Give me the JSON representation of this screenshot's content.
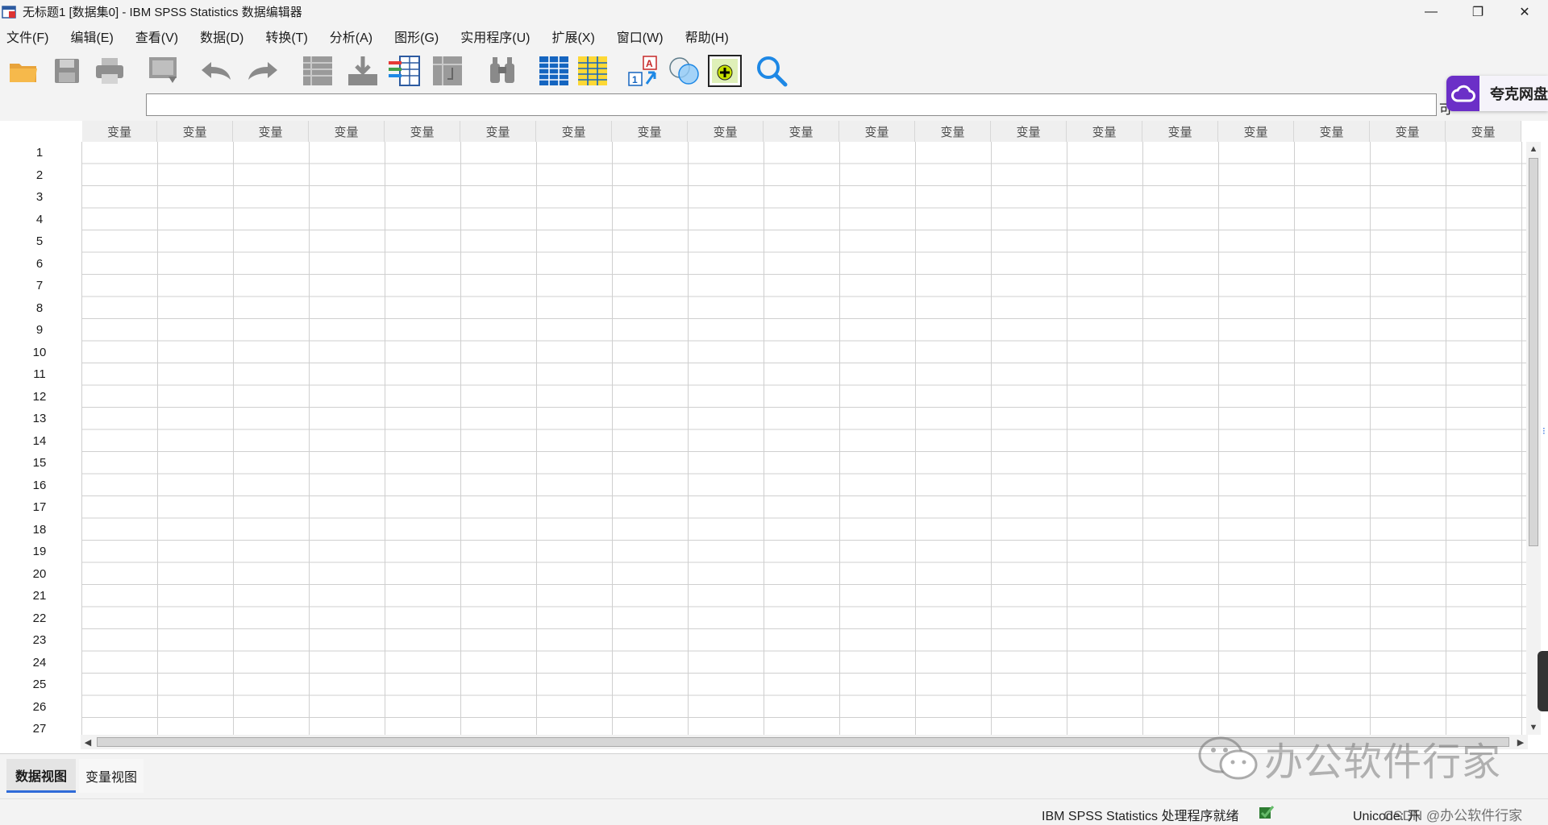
{
  "window": {
    "title": "无标题1 [数据集0] - IBM SPSS Statistics 数据编辑器",
    "controls": [
      "—",
      "❐",
      "✕"
    ]
  },
  "menu": [
    "文件(F)",
    "编辑(E)",
    "查看(V)",
    "数据(D)",
    "转换(T)",
    "分析(A)",
    "图形(G)",
    "实用程序(U)",
    "扩展(X)",
    "窗口(W)",
    "帮助(H)"
  ],
  "toolbar": {
    "icons": [
      "open-folder-icon",
      "save-icon",
      "print-icon",
      "recall-dialog-icon",
      "undo-icon",
      "redo-icon",
      "goto-case-icon",
      "goto-variable-icon",
      "variables-icon",
      "run-descriptives-icon",
      "find-icon",
      "insert-cases-icon",
      "insert-variable-icon",
      "split-file-icon",
      "select-cases-icon",
      "value-labels-icon",
      "use-variable-sets-icon",
      "search-icon"
    ]
  },
  "formula": {
    "value": "",
    "visible_label_partial": "可"
  },
  "quark": {
    "label": "夸克网盘"
  },
  "grid": {
    "column_header": "变量",
    "column_count": 19,
    "rows": [
      "1",
      "2",
      "3",
      "4",
      "5",
      "6",
      "7",
      "8",
      "9",
      "10",
      "11",
      "12",
      "13",
      "14",
      "15",
      "16",
      "17",
      "18",
      "19",
      "20",
      "21",
      "22",
      "23",
      "24",
      "25",
      "26",
      "27"
    ]
  },
  "tabs": {
    "data_view": "数据视图",
    "variable_view": "变量视图"
  },
  "status": {
    "ready": "IBM SPSS Statistics 处理程序就绪",
    "unicode": "Unicode: 开"
  },
  "watermark": {
    "text": "办公软件行家",
    "csdn": "CSDN @办公软件行家"
  },
  "colors": {
    "accent": "#2f6bd8",
    "quark_purple": "#6b2fc7",
    "grid_line": "#cfcfcf"
  }
}
